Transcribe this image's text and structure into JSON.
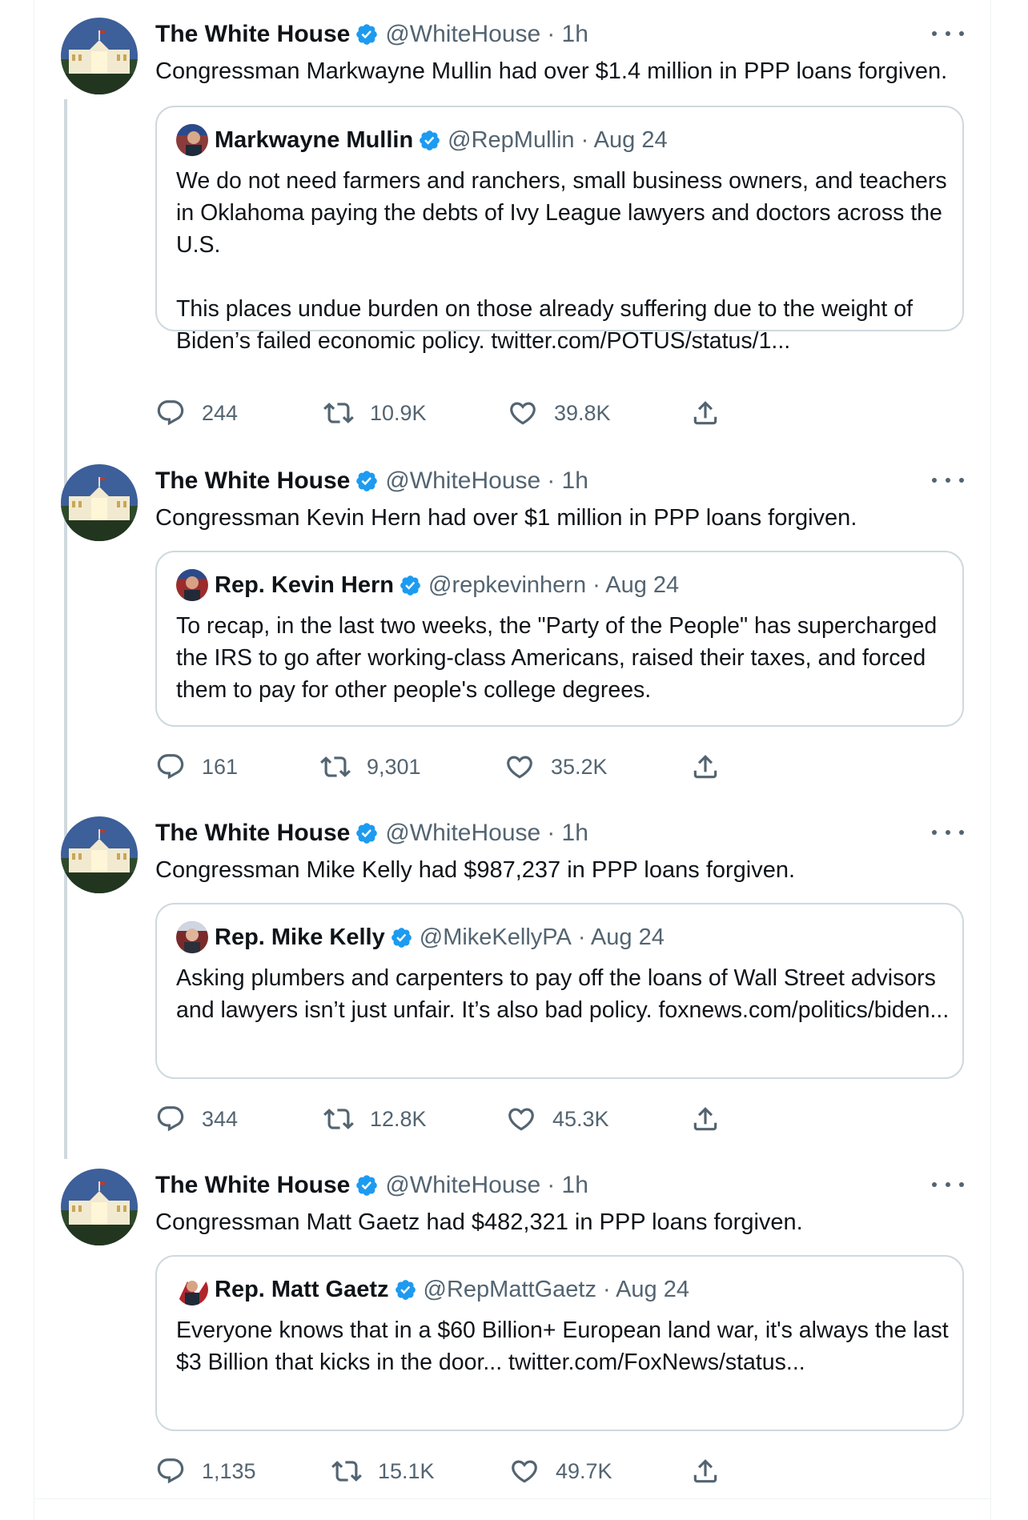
{
  "colors": {
    "text": "#0f1419",
    "secondary": "#536471",
    "verified": "#1d9bf0",
    "border": "#cfd9de",
    "thread_line": "#cfd9de"
  },
  "icons": [
    "verified-badge-icon",
    "more-icon",
    "reply-icon",
    "retweet-icon",
    "like-icon",
    "share-icon"
  ],
  "tweets": [
    {
      "author": {
        "name": "The White House",
        "handle": "@WhiteHouse",
        "time": "· 1h"
      },
      "text": "Congressman Markwayne Mullin had over $1.4 million in PPP loans forgiven.",
      "quote": {
        "name": "Markwayne Mullin",
        "handle": "@RepMullin",
        "date": "· Aug 24",
        "paragraphs": [
          "We do not need farmers and ranchers, small business owners, and teachers in Oklahoma paying the debts of Ivy League lawyers and doctors across the U.S.",
          "This places undue burden on those already suffering due to the weight of Biden’s failed economic policy. twitter.com/POTUS/status/1..."
        ]
      },
      "stats": {
        "replies": "244",
        "retweets": "10.9K",
        "likes": "39.8K"
      }
    },
    {
      "author": {
        "name": "The White House",
        "handle": "@WhiteHouse",
        "time": "· 1h"
      },
      "text": "Congressman Kevin Hern had over $1 million in PPP loans forgiven.",
      "quote": {
        "name": "Rep. Kevin Hern",
        "handle": "@repkevinhern",
        "date": "· Aug 24",
        "paragraphs": [
          "To recap, in the last two weeks, the \"Party of the People\" has supercharged the IRS to go after working-class Americans, raised their taxes, and forced them to pay for other people's college degrees."
        ]
      },
      "stats": {
        "replies": "161",
        "retweets": "9,301",
        "likes": "35.2K"
      }
    },
    {
      "author": {
        "name": "The White House",
        "handle": "@WhiteHouse",
        "time": "· 1h"
      },
      "text": "Congressman Mike Kelly had $987,237 in PPP loans forgiven.",
      "quote": {
        "name": "Rep. Mike Kelly",
        "handle": "@MikeKellyPA",
        "date": "· Aug 24",
        "paragraphs": [
          "Asking plumbers and carpenters to pay off the loans of Wall Street advisors and lawyers isn’t just unfair. It’s also bad policy. foxnews.com/politics/biden..."
        ]
      },
      "stats": {
        "replies": "344",
        "retweets": "12.8K",
        "likes": "45.3K"
      }
    },
    {
      "author": {
        "name": "The White House",
        "handle": "@WhiteHouse",
        "time": "· 1h"
      },
      "text": "Congressman Matt Gaetz had $482,321 in PPP loans forgiven.",
      "quote": {
        "name": "Rep. Matt Gaetz",
        "handle": "@RepMattGaetz",
        "date": "· Aug 24",
        "paragraphs": [
          "Everyone knows that in a $60 Billion+ European land war, it's always the last $3 Billion that kicks in the door... twitter.com/FoxNews/status..."
        ]
      },
      "stats": {
        "replies": "1,135",
        "retweets": "15.1K",
        "likes": "49.7K"
      }
    }
  ]
}
